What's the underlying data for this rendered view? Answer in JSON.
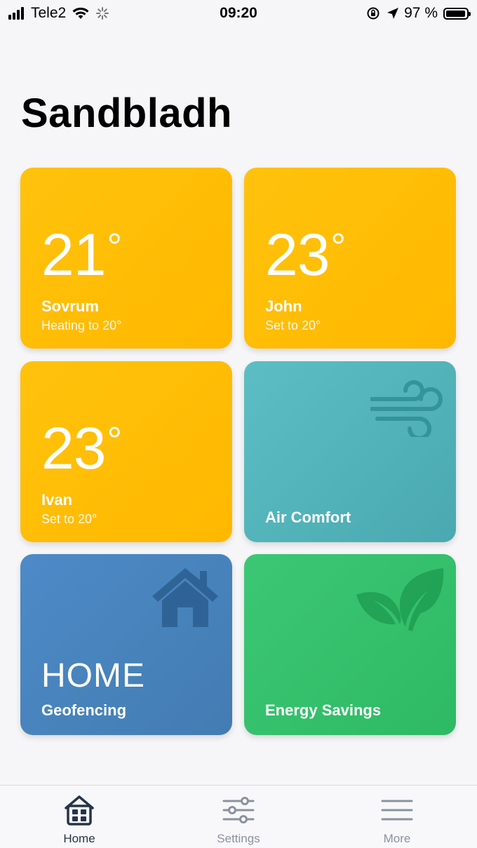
{
  "status_bar": {
    "carrier": "Tele2",
    "time": "09:20",
    "battery_percent": "97 %",
    "battery_level": 0.97
  },
  "page": {
    "title": "Sandbladh"
  },
  "tiles": [
    {
      "type": "room",
      "temp": "21",
      "deg": "°",
      "name": "Sovrum",
      "status": "Heating to 20°",
      "color": "#ffbe08"
    },
    {
      "type": "room",
      "temp": "23",
      "deg": "°",
      "name": "John",
      "status": "Set to 20°",
      "color": "#ffbe08"
    },
    {
      "type": "room",
      "temp": "23",
      "deg": "°",
      "name": "Ivan",
      "status": "Set to 20°",
      "color": "#ffbe08"
    },
    {
      "type": "feature",
      "label": "Air Comfort",
      "icon": "wind-icon",
      "color": "#52b4ba"
    },
    {
      "type": "feature",
      "big": "HOME",
      "label": "Geofencing",
      "icon": "house-icon",
      "color": "#4884bd"
    },
    {
      "type": "feature",
      "label": "Energy Savings",
      "icon": "leaf-icon",
      "color": "#35c06c"
    }
  ],
  "tab_bar": {
    "tabs": [
      {
        "label": "Home",
        "icon": "home-grid-icon",
        "active": true
      },
      {
        "label": "Settings",
        "icon": "sliders-icon",
        "active": false
      },
      {
        "label": "More",
        "icon": "menu-icon",
        "active": false
      }
    ],
    "active_color": "#25344b",
    "inactive_color": "#8a939d"
  }
}
